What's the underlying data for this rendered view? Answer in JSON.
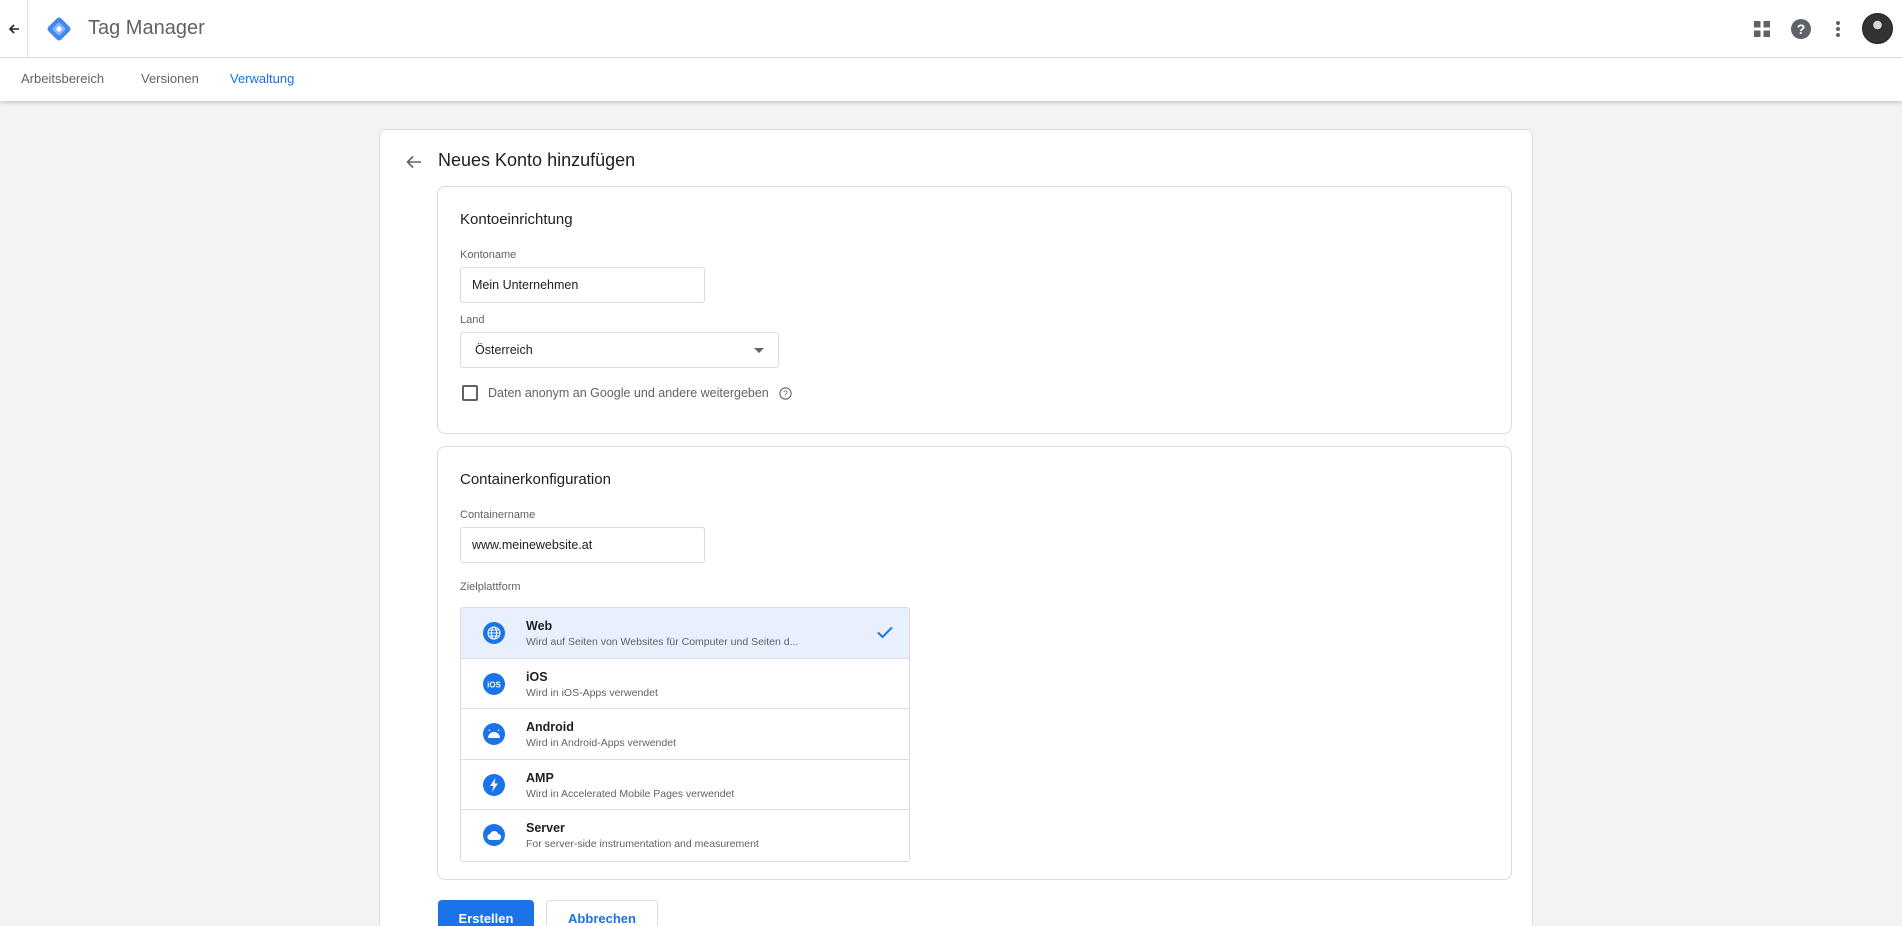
{
  "header": {
    "app_title": "Tag Manager",
    "brand_color": "#1a73e8",
    "icons": [
      "back-arrow-icon",
      "apps-grid-icon",
      "help-icon",
      "more-vert-icon",
      "avatar"
    ]
  },
  "tabs": [
    {
      "label": "Arbeitsbereich",
      "active": false
    },
    {
      "label": "Versionen",
      "active": false
    },
    {
      "label": "Verwaltung",
      "active": true
    }
  ],
  "page": {
    "title": "Neues Konto hinzufügen"
  },
  "account_setup": {
    "title": "Kontoeinrichtung",
    "account_name_label": "Kontoname",
    "account_name_value": "Mein Unternehmen",
    "country_label": "Land",
    "country_value": "Österreich",
    "share_data_label": "Daten anonym an Google und andere weitergeben",
    "share_data_checked": false
  },
  "container_setup": {
    "title": "Containerkonfiguration",
    "container_name_label": "Containername",
    "container_name_value": "www.meinewebsite.at",
    "target_platform_label": "Zielplattform",
    "platforms": [
      {
        "name": "Web",
        "description": "Wird auf Seiten von Websites für Computer und Seiten d...",
        "icon": "globe-icon",
        "selected": true
      },
      {
        "name": "iOS",
        "description": "Wird in iOS-Apps verwendet",
        "icon": "ios-icon",
        "selected": false
      },
      {
        "name": "Android",
        "description": "Wird in Android-Apps verwendet",
        "icon": "android-icon",
        "selected": false
      },
      {
        "name": "AMP",
        "description": "Wird in Accelerated Mobile Pages verwendet",
        "icon": "amp-bolt-icon",
        "selected": false
      },
      {
        "name": "Server",
        "description": "For server-side instrumentation and measurement",
        "icon": "cloud-icon",
        "selected": false
      }
    ]
  },
  "actions": {
    "create_label": "Erstellen",
    "cancel_label": "Abbrechen"
  }
}
